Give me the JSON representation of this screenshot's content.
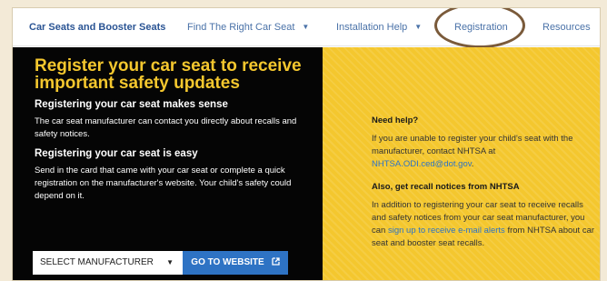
{
  "nav": {
    "brand": "Car Seats and Booster Seats",
    "items": [
      {
        "label": "Find The Right Car Seat",
        "dropdown": true
      },
      {
        "label": "Installation Help",
        "dropdown": true
      },
      {
        "label": "Registration",
        "dropdown": false
      },
      {
        "label": "Resources",
        "dropdown": false
      }
    ],
    "caret_icon": "chevron-down-icon"
  },
  "hero": {
    "headline": "Register your car seat to receive important safety updates",
    "section1_title": "Registering your car seat makes sense",
    "section1_text": "The car seat manufacturer can contact you directly about recalls and safety notices.",
    "section2_title": "Registering your car seat is easy",
    "section2_text": "Send in the card that came with your car seat or complete a quick registration on the manufacturer's website. Your child's safety could depend on it.",
    "select_value": "SELECT MANUFACTURER",
    "button_label": "GO TO WEBSITE",
    "button_icon": "external-link-icon"
  },
  "aside": {
    "help_title": "Need help?",
    "help_text_before": "If you are unable to register your child's seat with the manufacturer, contact NHTSA at",
    "help_email": "NHTSA.ODI.ced@dot.gov",
    "help_text_after": ".",
    "recall_title": "Also, get recall notices from NHTSA",
    "recall_text_before": "In addition to registering your car seat to receive recalls and safety notices from your car seat manufacturer, you can",
    "recall_link": "sign up to receive e-mail alerts",
    "recall_text_after": "from NHTSA about car seat and booster seat recalls."
  },
  "colors": {
    "accent_yellow": "#f4c72e",
    "link_blue": "#2e73c4",
    "annotation_brown": "#7a5a3a"
  }
}
